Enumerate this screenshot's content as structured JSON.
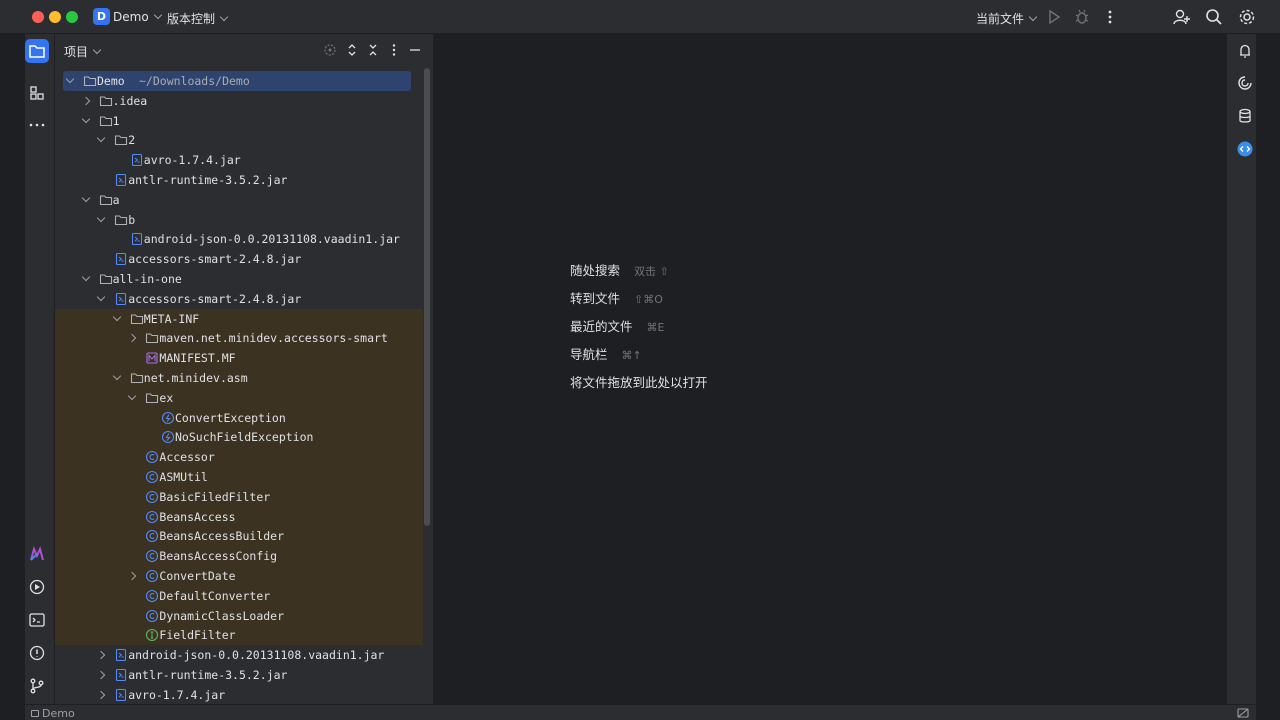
{
  "titlebar": {
    "project_badge": "D",
    "project_name": "Demo",
    "vcs_label": "版本控制",
    "run_config": "当前文件"
  },
  "panel": {
    "title": "项目"
  },
  "tree": [
    {
      "label": "Demo",
      "path": "~/Downloads/Demo",
      "depth": 0,
      "arrow": "down",
      "icon": "folder-icon",
      "selected": true,
      "lib": false
    },
    {
      "label": ".idea",
      "depth": 1,
      "arrow": "right",
      "icon": "folder-icon",
      "lib": false
    },
    {
      "label": "1",
      "depth": 1,
      "arrow": "down",
      "icon": "folder-icon",
      "lib": false
    },
    {
      "label": "2",
      "depth": 2,
      "arrow": "down",
      "icon": "folder-icon",
      "lib": false
    },
    {
      "label": "avro-1.7.4.jar",
      "depth": 3,
      "arrow": "none",
      "icon": "jar-icon",
      "lib": false
    },
    {
      "label": "antlr-runtime-3.5.2.jar",
      "depth": 2,
      "arrow": "none",
      "icon": "jar-icon",
      "lib": false
    },
    {
      "label": "a",
      "depth": 1,
      "arrow": "down",
      "icon": "folder-icon",
      "lib": false
    },
    {
      "label": "b",
      "depth": 2,
      "arrow": "down",
      "icon": "folder-icon",
      "lib": false
    },
    {
      "label": "android-json-0.0.20131108.vaadin1.jar",
      "depth": 3,
      "arrow": "none",
      "icon": "jar-icon",
      "lib": false
    },
    {
      "label": "accessors-smart-2.4.8.jar",
      "depth": 2,
      "arrow": "none",
      "icon": "jar-icon",
      "lib": false
    },
    {
      "label": "all-in-one",
      "depth": 1,
      "arrow": "down",
      "icon": "folder-icon",
      "lib": false
    },
    {
      "label": "accessors-smart-2.4.8.jar",
      "depth": 2,
      "arrow": "down",
      "icon": "jar-icon",
      "lib": false
    },
    {
      "label": "META-INF",
      "depth": 3,
      "arrow": "down",
      "icon": "folder-icon",
      "lib": true
    },
    {
      "label": "maven.net.minidev.accessors-smart",
      "depth": 4,
      "arrow": "right",
      "icon": "folder-icon",
      "lib": true
    },
    {
      "label": "MANIFEST.MF",
      "depth": 4,
      "arrow": "none",
      "icon": "manifest-icon",
      "lib": true
    },
    {
      "label": "net.minidev.asm",
      "depth": 3,
      "arrow": "down",
      "icon": "folder-icon",
      "lib": true
    },
    {
      "label": "ex",
      "depth": 4,
      "arrow": "down",
      "icon": "folder-icon",
      "lib": true
    },
    {
      "label": "ConvertException",
      "depth": 5,
      "arrow": "none",
      "icon": "exception-class-icon",
      "lib": true
    },
    {
      "label": "NoSuchFieldException",
      "depth": 5,
      "arrow": "none",
      "icon": "exception-class-icon",
      "lib": true
    },
    {
      "label": "Accessor",
      "depth": 4,
      "arrow": "none",
      "icon": "class-icon",
      "lib": true
    },
    {
      "label": "ASMUtil",
      "depth": 4,
      "arrow": "none",
      "icon": "class-icon",
      "lib": true
    },
    {
      "label": "BasicFiledFilter",
      "depth": 4,
      "arrow": "none",
      "icon": "class-icon",
      "lib": true
    },
    {
      "label": "BeansAccess",
      "depth": 4,
      "arrow": "none",
      "icon": "class-icon",
      "lib": true
    },
    {
      "label": "BeansAccessBuilder",
      "depth": 4,
      "arrow": "none",
      "icon": "class-icon",
      "lib": true
    },
    {
      "label": "BeansAccessConfig",
      "depth": 4,
      "arrow": "none",
      "icon": "class-icon",
      "lib": true
    },
    {
      "label": "ConvertDate",
      "depth": 4,
      "arrow": "right",
      "icon": "class-icon",
      "lib": true
    },
    {
      "label": "DefaultConverter",
      "depth": 4,
      "arrow": "none",
      "icon": "class-icon",
      "lib": true
    },
    {
      "label": "DynamicClassLoader",
      "depth": 4,
      "arrow": "none",
      "icon": "class-icon",
      "lib": true
    },
    {
      "label": "FieldFilter",
      "depth": 4,
      "arrow": "none",
      "icon": "interface-icon",
      "lib": true
    },
    {
      "label": "android-json-0.0.20131108.vaadin1.jar",
      "depth": 2,
      "arrow": "right",
      "icon": "jar-icon",
      "lib": false
    },
    {
      "label": "antlr-runtime-3.5.2.jar",
      "depth": 2,
      "arrow": "right",
      "icon": "jar-icon",
      "lib": false
    },
    {
      "label": "avro-1.7.4.jar",
      "depth": 2,
      "arrow": "right",
      "icon": "jar-icon",
      "lib": false
    }
  ],
  "editor": {
    "hints": [
      {
        "label": "随处搜索",
        "key": "双击 ⇧"
      },
      {
        "label": "转到文件",
        "key": "⇧⌘O"
      },
      {
        "label": "最近的文件",
        "key": "⌘E"
      },
      {
        "label": "导航栏",
        "key": "⌘↑"
      },
      {
        "label": "将文件拖放到此处以打开",
        "key": ""
      }
    ]
  },
  "statusbar": {
    "project": "Demo"
  },
  "colors": {
    "accent": "#3574f0",
    "library_bg": "#3b3222",
    "selection_bg": "#2e436e",
    "class_icon": "#548af7",
    "interface_icon": "#5fb865",
    "manifest_icon": "#a571e6"
  }
}
